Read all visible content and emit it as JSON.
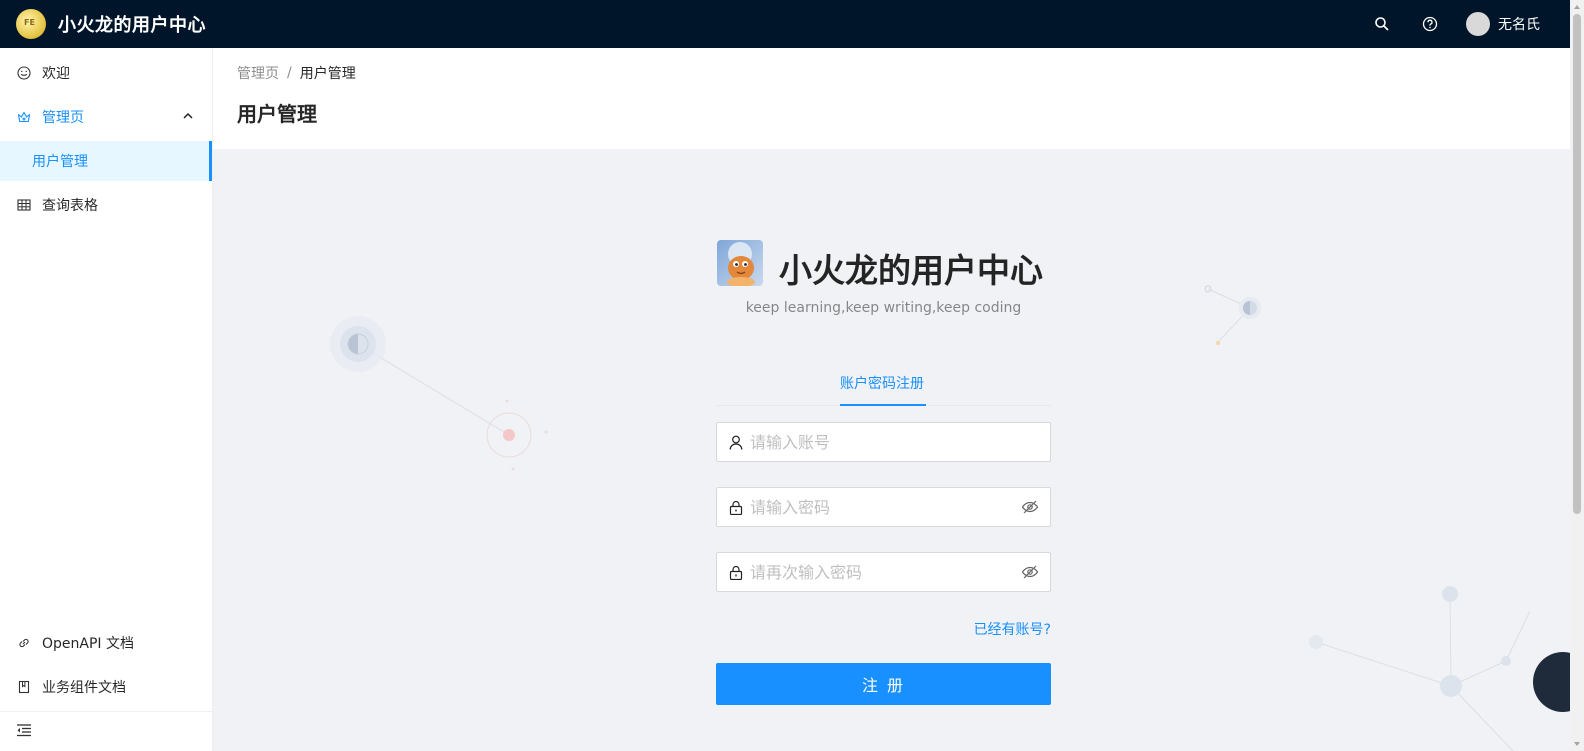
{
  "app": {
    "title": "小火龙的用户中心",
    "user_name": "无名氏"
  },
  "sidebar": {
    "items": [
      {
        "label": "欢迎",
        "icon": "smile-icon"
      },
      {
        "label": "管理页",
        "icon": "crown-icon",
        "open": true
      },
      {
        "label": "用户管理",
        "selected": true
      },
      {
        "label": "查询表格",
        "icon": "table-icon"
      }
    ],
    "bottom": [
      {
        "label": "OpenAPI 文档",
        "icon": "link-icon"
      },
      {
        "label": "业务组件文档",
        "icon": "book-icon"
      }
    ],
    "collapse_icon": "menu-fold-icon"
  },
  "page": {
    "breadcrumb": [
      "管理页",
      "用户管理"
    ],
    "breadcrumb_sep": "/",
    "title": "用户管理"
  },
  "register": {
    "title": "小火龙的用户中心",
    "subtitle": "keep learning,keep writing,keep coding",
    "tab_label": "账户密码注册",
    "account_placeholder": "请输入账号",
    "password_placeholder": "请输入密码",
    "confirm_placeholder": "请再次输入密码",
    "have_account": "已经有账号?",
    "submit_label": "注 册"
  },
  "colors": {
    "primary": "#1890ff",
    "header_bg": "#001529",
    "content_bg": "#f0f2f5"
  }
}
